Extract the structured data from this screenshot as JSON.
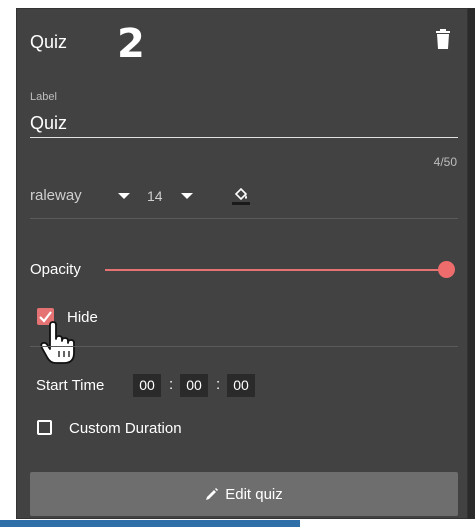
{
  "header": {
    "title": "Quiz",
    "annotation_number": "2"
  },
  "label_field": {
    "caption": "Label",
    "value": "Quiz",
    "counter": "4/50"
  },
  "font": {
    "family": "raleway",
    "size": "14"
  },
  "opacity": {
    "label": "Opacity",
    "value_fraction": 1.0
  },
  "hide": {
    "label": "Hide",
    "checked": true
  },
  "start_time": {
    "label": "Start Time",
    "hours": "00",
    "minutes": "00",
    "seconds": "00",
    "separator": ":"
  },
  "custom_duration": {
    "label": "Custom Duration",
    "checked": false
  },
  "edit_button": {
    "label": "Edit quiz"
  },
  "colors": {
    "panel_bg": "#424242",
    "accent": "#e57373",
    "button_bg": "#6e6e6e"
  }
}
